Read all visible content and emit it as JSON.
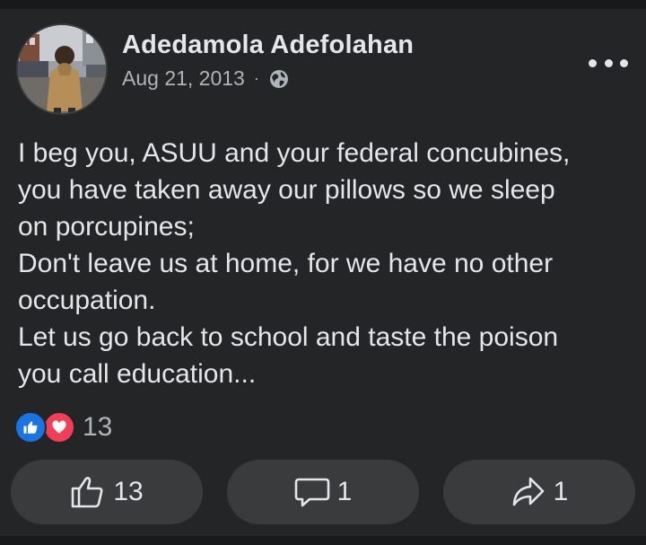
{
  "post": {
    "author": "Adedamola Adefolahan",
    "date": "Aug 21, 2013",
    "separator": "·",
    "privacy_icon": "globe-icon",
    "text_lines": [
      "I beg you, ASUU and your federal concubines,",
      "you have taken away our pillows so we sleep",
      "on porcupines;",
      "Don't leave us at home, for we have no other",
      "occupation.",
      "Let us go back to school and taste the poison",
      "you call education..."
    ]
  },
  "reactions": {
    "icons": [
      "like-reaction-icon",
      "love-reaction-icon"
    ],
    "count": "13"
  },
  "actions": {
    "like_count": "13",
    "comment_count": "1",
    "share_count": "1"
  },
  "colors": {
    "background": "#242526",
    "button": "#3a3b3c",
    "like_blue": "#1b74e4",
    "love_red": "#f33e58",
    "text_primary": "#e4e6eb",
    "text_secondary": "#b0b3b8"
  }
}
